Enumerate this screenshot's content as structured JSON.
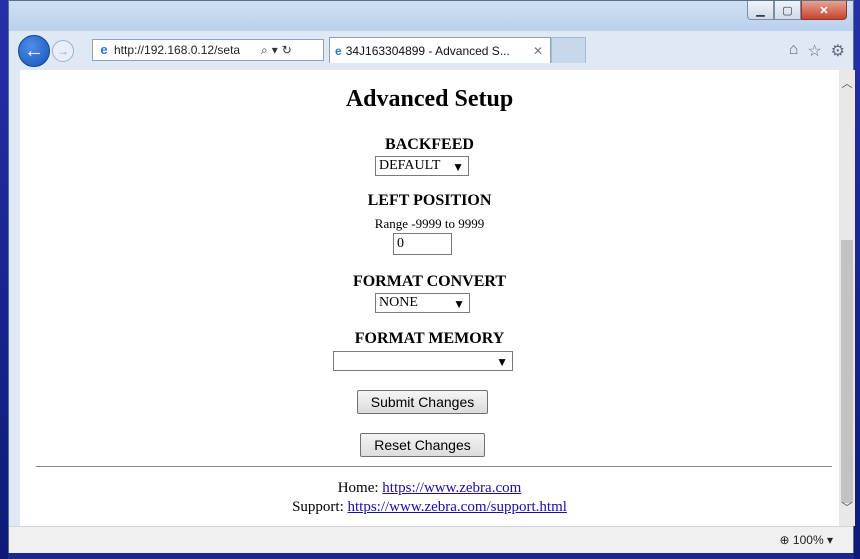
{
  "browser": {
    "address_url_host": "http://192.168.0.12",
    "address_url_rest": "/seta",
    "tab_title": "34J163304899 - Advanced S...",
    "zoom": "100%"
  },
  "page": {
    "title": "Advanced Setup",
    "backfeed": {
      "label": "BACKFEED",
      "value": "DEFAULT"
    },
    "left_position": {
      "label": "LEFT POSITION",
      "range": "Range -9999 to 9999",
      "value": "0"
    },
    "format_convert": {
      "label": "FORMAT CONVERT",
      "value": "NONE"
    },
    "format_memory": {
      "label": "FORMAT MEMORY",
      "value": ""
    },
    "submit_label": "Submit Changes",
    "reset_label": "Reset Changes",
    "home_label": "Home:",
    "home_link": "https://www.zebra.com",
    "support_label": "Support:",
    "support_link": "https://www.zebra.com/support.html"
  }
}
